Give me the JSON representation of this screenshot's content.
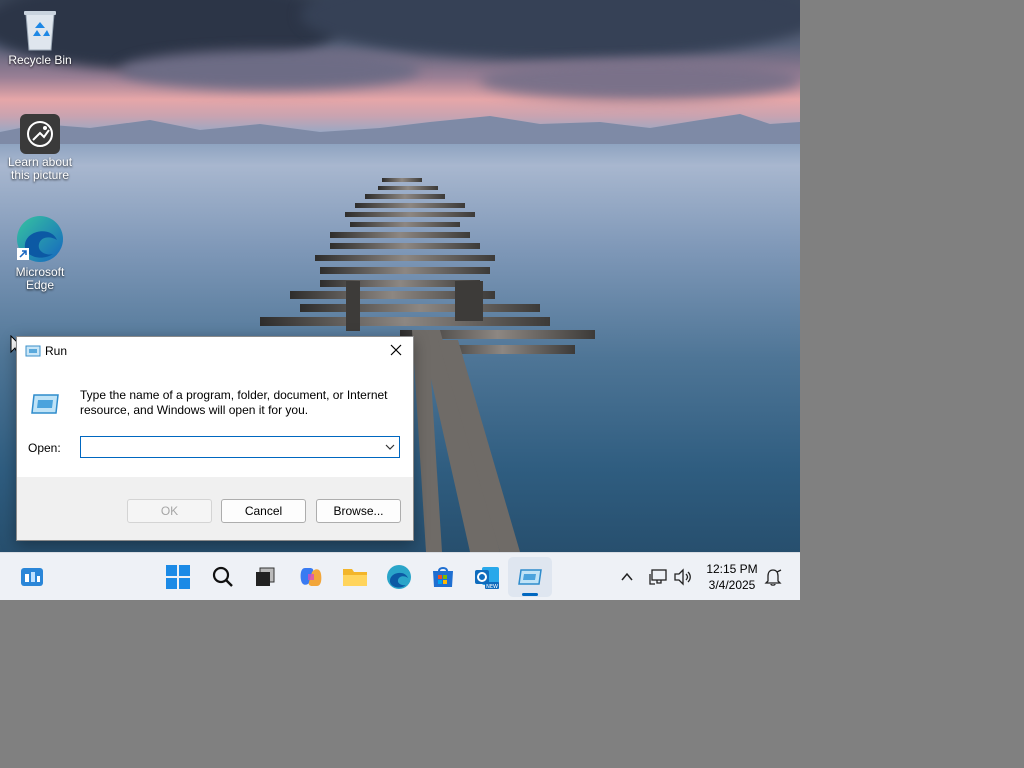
{
  "desktop": {
    "icons": [
      {
        "label": "Recycle Bin"
      },
      {
        "label": "Learn about this picture"
      },
      {
        "label": "Microsoft Edge"
      }
    ]
  },
  "run_dialog": {
    "title": "Run",
    "description": "Type the name of a program, folder, document, or Internet resource, and Windows will open it for you.",
    "open_label": "Open:",
    "open_value": "",
    "ok_label": "OK",
    "cancel_label": "Cancel",
    "browse_label": "Browse..."
  },
  "taskbar": {
    "apps": [
      "widgets-icon",
      "start-icon",
      "search-icon",
      "task-view-icon",
      "copilot-icon",
      "file-explorer-icon",
      "edge-icon",
      "store-icon",
      "outlook-icon",
      "run-icon"
    ],
    "clock": {
      "time": "12:15 PM",
      "date": "3/4/2025"
    },
    "accent": "#0067c0"
  }
}
